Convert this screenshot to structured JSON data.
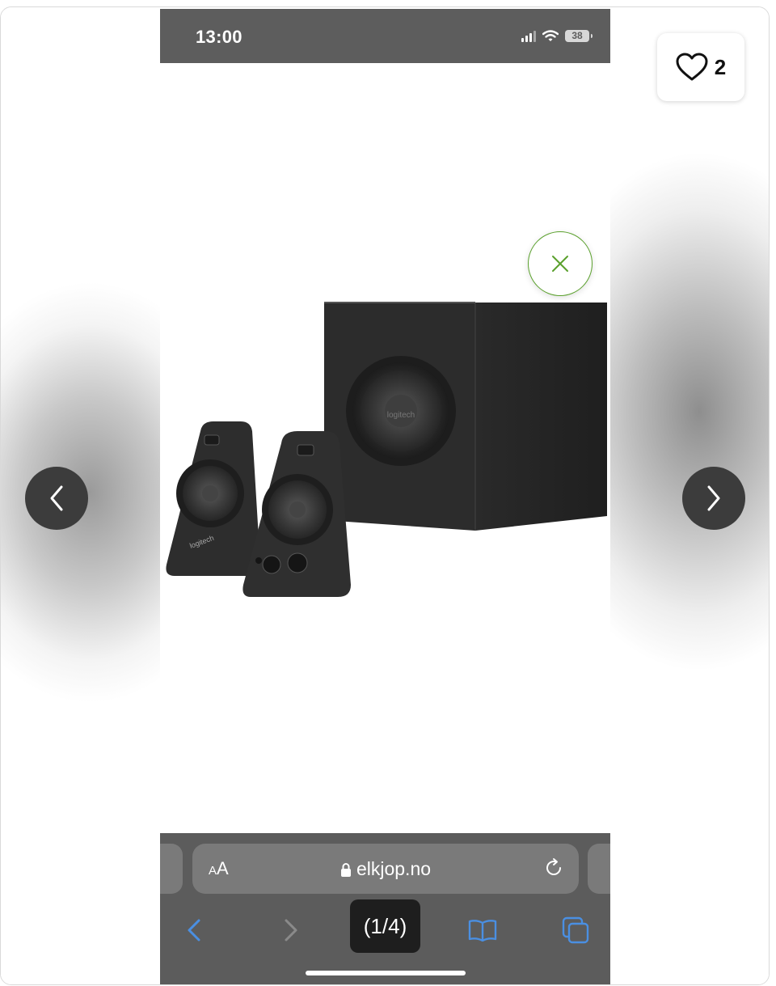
{
  "status_bar": {
    "time": "13:00",
    "battery": "38"
  },
  "favorite": {
    "count": "2"
  },
  "product_image": {
    "brand_mark": "logitech"
  },
  "browser": {
    "text_size_label_small": "A",
    "text_size_label_large": "A",
    "url": "elkjop.no",
    "page_counter": "(1/4)"
  },
  "icons": {
    "heart": "heart-icon",
    "close": "close-icon",
    "prev": "chevron-left-icon",
    "next": "chevron-right-icon",
    "lock": "lock-icon",
    "reload": "reload-icon",
    "back": "back-icon",
    "forward": "forward-icon",
    "share": "share-icon",
    "bookmarks": "bookmarks-icon",
    "tabs": "tabs-icon"
  },
  "colors": {
    "accent_green": "#5aa02c",
    "safari_blue": "#4a8fe2",
    "status_bar_bg": "#5d5d5d"
  }
}
